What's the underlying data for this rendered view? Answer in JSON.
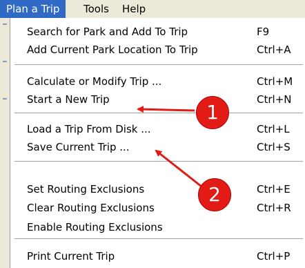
{
  "menubar": {
    "items": [
      {
        "label": "Plan a Trip",
        "active": true
      },
      {
        "label": "Tools"
      },
      {
        "label": "Help"
      }
    ]
  },
  "menu": {
    "items": [
      {
        "label": "Search for Park and Add To Trip",
        "shortcut": "F9"
      },
      {
        "label": "Add Current Park Location To Trip",
        "shortcut": "Ctrl+A"
      },
      {
        "label": "Calculate or Modify Trip ...",
        "shortcut": "Ctrl+M"
      },
      {
        "label": "Start a New Trip",
        "shortcut": "Ctrl+N"
      },
      {
        "label": "Load a Trip From Disk ...",
        "shortcut": "Ctrl+L"
      },
      {
        "label": "Save Current Trip ...",
        "shortcut": "Ctrl+S"
      },
      {
        "label": "Set Routing Exclusions",
        "shortcut": "Ctrl+E"
      },
      {
        "label": "Clear Routing Exclusions",
        "shortcut": "Ctrl+R"
      },
      {
        "label": "Enable Routing Exclusions",
        "shortcut": ""
      },
      {
        "label": "Print Current Trip",
        "shortcut": "Ctrl+P"
      }
    ]
  },
  "annotations": {
    "callout_1": "1",
    "callout_2": "2",
    "color": "#e31b17"
  },
  "colors": {
    "highlight": "#316ac5",
    "menubar_bg": "#ece9d8"
  }
}
